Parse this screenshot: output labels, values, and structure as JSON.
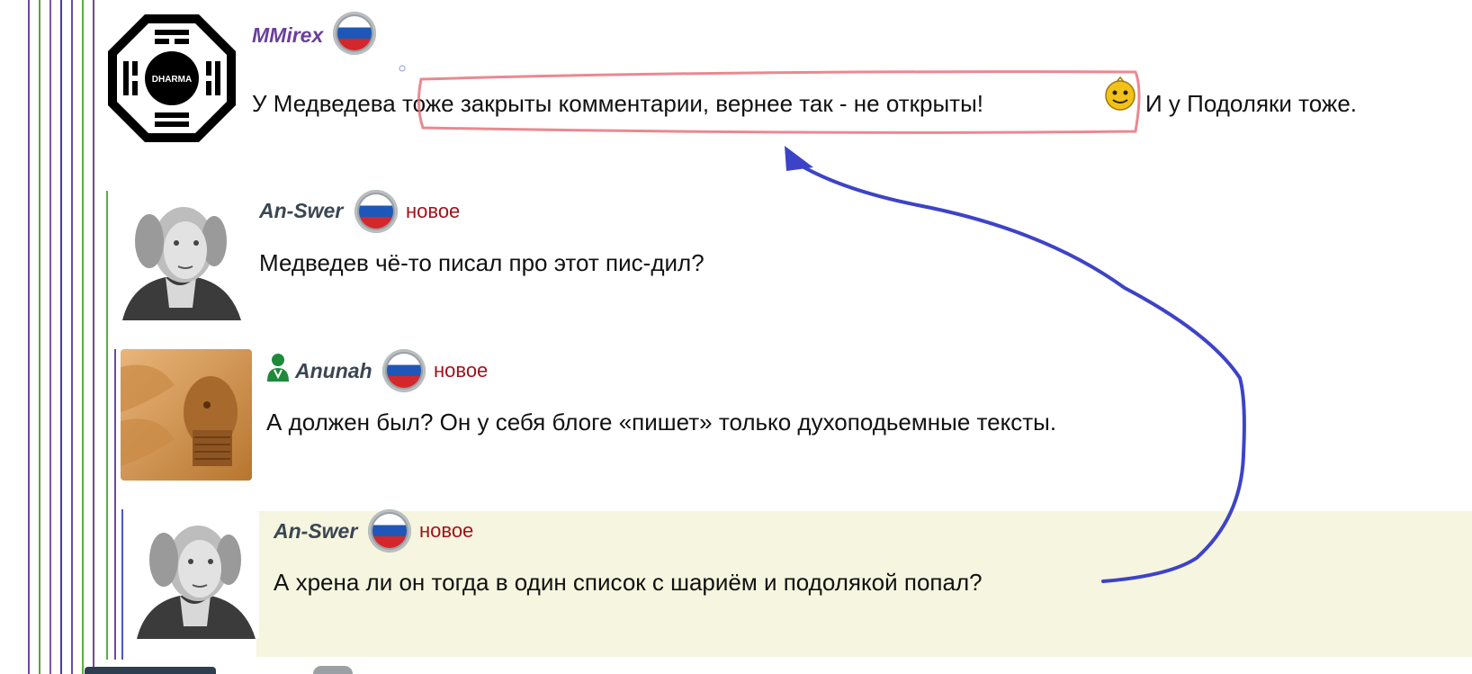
{
  "colors": {
    "author": "#3a4652",
    "author_first": "#6a3f9c",
    "new_badge": "#a0121a",
    "highlight_bg": "#f6f5df",
    "annotation_red": "#e8737c",
    "annotation_blue": "#3d43c8"
  },
  "comments": [
    {
      "author": "MMirex",
      "flag_icon": "russia-flag-icon",
      "avatar_icon": "dharma-logo-avatar",
      "text_before": "У Медведева ",
      "text_highlighted": "тоже закрыты комментарии, вернее так - не открыты!",
      "emoji_icon": "smiley-icon",
      "text_after": "И у Подоляки тоже."
    },
    {
      "author": "An-Swer",
      "flag_icon": "russia-flag-icon",
      "avatar_icon": "portrait-avatar",
      "badge": "новое",
      "text": "Медведев чё-то писал про этот пис-дил?"
    },
    {
      "author": "Anunah",
      "flag_icon": "russia-flag-icon",
      "user_icon": "verified-user-icon",
      "avatar_icon": "relief-avatar",
      "badge": "новое",
      "text": "А должен был? Он у себя блоге «пишет» только духоподьемные тексты."
    },
    {
      "author": "An-Swer",
      "flag_icon": "russia-flag-icon",
      "avatar_icon": "portrait-avatar",
      "badge": "новое",
      "text": "А хрена ли он тогда в один список с шариём и подолякой попал?"
    }
  ]
}
